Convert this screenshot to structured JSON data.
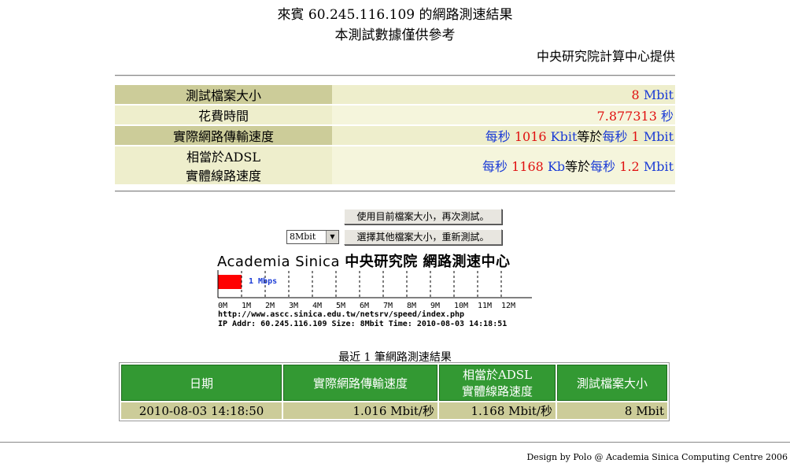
{
  "header": {
    "title": "來賓 60.245.116.109 的網路測速結果",
    "subtitle": "本測試數據僅供參考",
    "provider": "中央研究院計算中心提供"
  },
  "results": {
    "file_size": {
      "label": "測試檔案大小",
      "num": "8",
      "unit": "Mbit"
    },
    "time_spent": {
      "label": "花費時間",
      "num": "7.877313",
      "unit": "秒"
    },
    "speed": {
      "label": "實際網路傳輸速度",
      "pre": "每秒",
      "num": "1016",
      "unit": "Kbit",
      "mid": "等於",
      "pre2": "每秒",
      "num2": "1",
      "unit2": "Mbit"
    },
    "adsl": {
      "label_line1": "相當於ADSL",
      "label_line2": "實體線路速度",
      "pre": "每秒",
      "num": "1168",
      "unit": "Kb",
      "mid": "等於",
      "pre2": "每秒",
      "num2": "1.2",
      "unit2": "Mbit"
    }
  },
  "controls": {
    "retest_button": "使用目前檔案大小，再次測試。",
    "other_size_button": "選擇其他檔案大小，重新測試。",
    "size_select_value": "8Mbit"
  },
  "banner": {
    "latin": "Academia Sinica",
    "cjk": "中央研究院 網路測速中心",
    "speed_label": "1 Mbps",
    "speed_value": 1,
    "scale_max": 12,
    "ticks": [
      "0M",
      "1M",
      "2M",
      "3M",
      "4M",
      "5M",
      "6M",
      "7M",
      "8M",
      "9M",
      "10M",
      "11M",
      "12M"
    ],
    "url": "http://www.ascc.sinica.edu.tw/netsrv/speed/index.php",
    "info": "IP Addr: 60.245.116.109 Size: 8Mbit Time: 2010-08-03 14:18:51",
    "bar_color": "#ff0000"
  },
  "history": {
    "title": "最近 1 筆網路測速結果",
    "headers": [
      "日期",
      "實際網路傳輸速度",
      "相當於ADSL",
      "實體線路速度",
      "測試檔案大小"
    ],
    "rows": [
      {
        "date": "2010-08-03 14:18:50",
        "speed": "1.016 Mbit/秒",
        "adsl": "1.168 Mbit/秒",
        "size": "8 Mbit"
      }
    ],
    "header_color": "#339933"
  },
  "footer": {
    "text": "Design by Polo @ Academia Sinica Computing Centre 2006"
  }
}
